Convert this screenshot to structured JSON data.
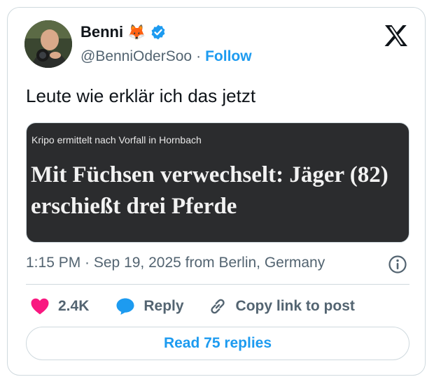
{
  "author": {
    "display_name": "Benni",
    "emoji": "🦊",
    "handle": "@BenniOderSoo",
    "separator": "·",
    "follow_label": "Follow",
    "verified_icon": "verified-badge-icon",
    "avatar_icon": "avatar-photo"
  },
  "brand": {
    "logo": "x-logo-icon"
  },
  "tweet": {
    "text": "Leute wie erklär ich das jetzt",
    "media": {
      "kicker": "Kripo ermittelt nach Vorfall in Hornbach",
      "headline": "Mit Füchsen verwechselt: Jäger (82) erschießt drei Pferde"
    },
    "meta": "1:15 PM · Sep 19, 2025 from Berlin, Germany"
  },
  "actions": {
    "like_count": "2.4K",
    "reply_label": "Reply",
    "copy_label": "Copy link to post"
  },
  "footer": {
    "read_replies_label": "Read 75 replies"
  },
  "colors": {
    "accent": "#1d9bf0",
    "text": "#0f1419",
    "muted": "#536471",
    "like": "#f91880",
    "border": "#cfd9de",
    "media_bg": "#2b2c2e"
  }
}
